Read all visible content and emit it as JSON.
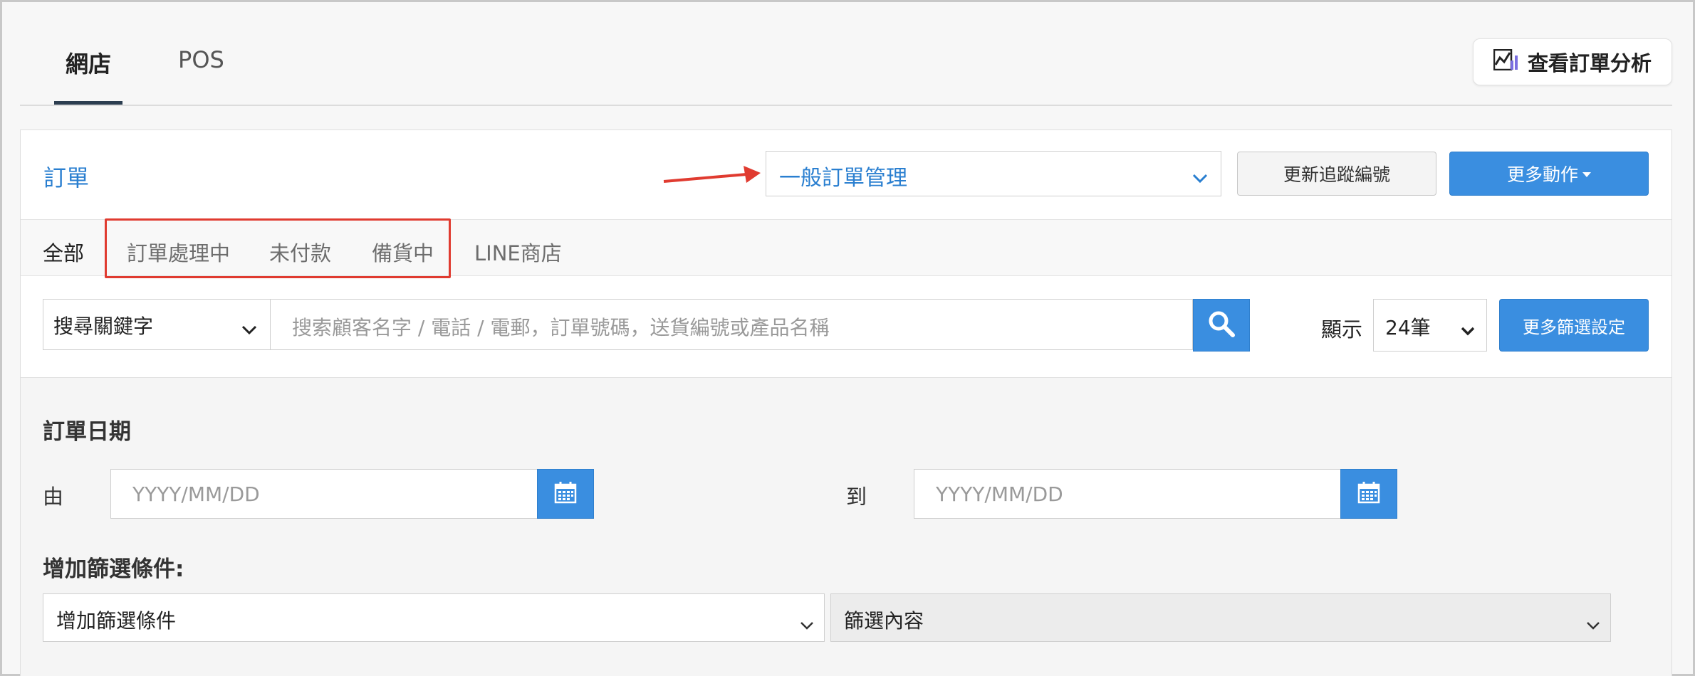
{
  "top_tabs": [
    {
      "label": "網店"
    },
    {
      "label": "POS"
    }
  ],
  "analysis_button": {
    "label": "查看訂單分析",
    "icon": "chart-icon"
  },
  "orders": {
    "title": "訂單",
    "view_select": "一般訂單管理",
    "update_tracking_label": "更新追蹤編號",
    "more_actions_label": "更多動作"
  },
  "status_tabs": [
    {
      "label": "全部"
    },
    {
      "label": "訂單處理中"
    },
    {
      "label": "未付款"
    },
    {
      "label": "備貨中"
    },
    {
      "label": "LINE商店"
    }
  ],
  "search": {
    "keyword_select": "搜尋關鍵字",
    "placeholder": "搜索顧客名字 / 電話 / 電郵，訂單號碼，送貨編號或產品名稱",
    "show_label": "顯示",
    "count_value": "24筆",
    "more_filters_label": "更多篩選設定"
  },
  "filters": {
    "date_title": "訂單日期",
    "from_label": "由",
    "to_label": "到",
    "date_placeholder": "YYYY/MM/DD",
    "add_condition_title": "增加篩選條件:",
    "add_condition_select": "增加篩選條件",
    "filter_content_select": "篩選內容"
  },
  "colors": {
    "accent_blue": "#3a8ee0",
    "link_blue": "#2a7fd0",
    "annotation_red": "#e03b30"
  }
}
